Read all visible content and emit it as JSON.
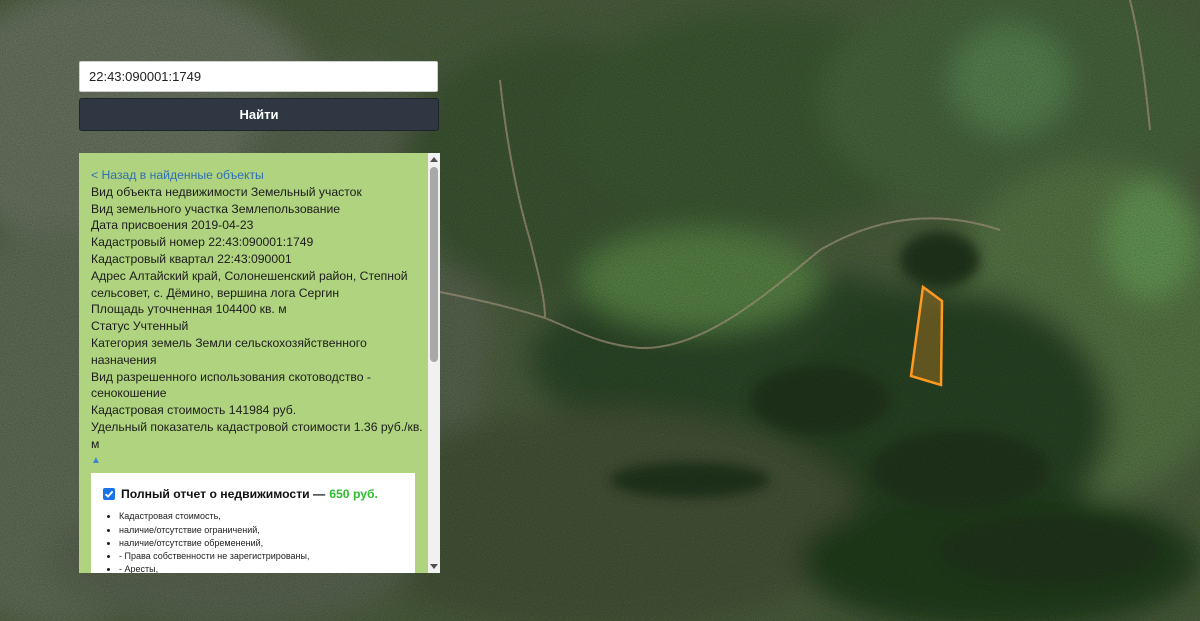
{
  "search": {
    "value": "22:43:090001:1749",
    "button_label": "Найти"
  },
  "info": {
    "back_link": "< Назад в найденные объекты",
    "properties": [
      "Вид объекта недвижимости Земельный участок",
      "Вид земельного участка Землепользование",
      "Дата присвоения 2019-04-23",
      "Кадастровый номер 22:43:090001:1749",
      "Кадастровый квартал 22:43:090001",
      "Адрес Алтайский край, Солонешенский район, Степной сельсовет, с. Дёмино, вершина лога Сергин",
      "Площадь уточненная 104400 кв. м",
      "Статус Учтенный",
      "Категория земель Земли сельскохозяйственного назначения",
      "Вид разрешенного использования скотоводство - сенокошение",
      "Кадастровая стоимость 141984 руб.",
      "Удельный показатель кадастровой стоимости 1.36 руб./кв. м"
    ],
    "collapse_symbol": "▲"
  },
  "report": {
    "title": "Полный отчет о недвижимости —",
    "price": "650 руб.",
    "items": [
      "Кадастровая стоимость,",
      "наличие/отсутствие ограничений,",
      "наличие/отсутствие обременений,",
      "- Права собственности не зарегистрированы,",
      "- Аресты,"
    ]
  },
  "colors": {
    "panel_bg": "#b0d37f",
    "button_bg": "#2e3742",
    "link": "#2d6fb6",
    "price": "#2ebd2e",
    "parcel_outline": "#ff9a1f"
  },
  "map": {
    "type": "satellite",
    "highlighted_parcel": "22:43:090001:1749"
  }
}
